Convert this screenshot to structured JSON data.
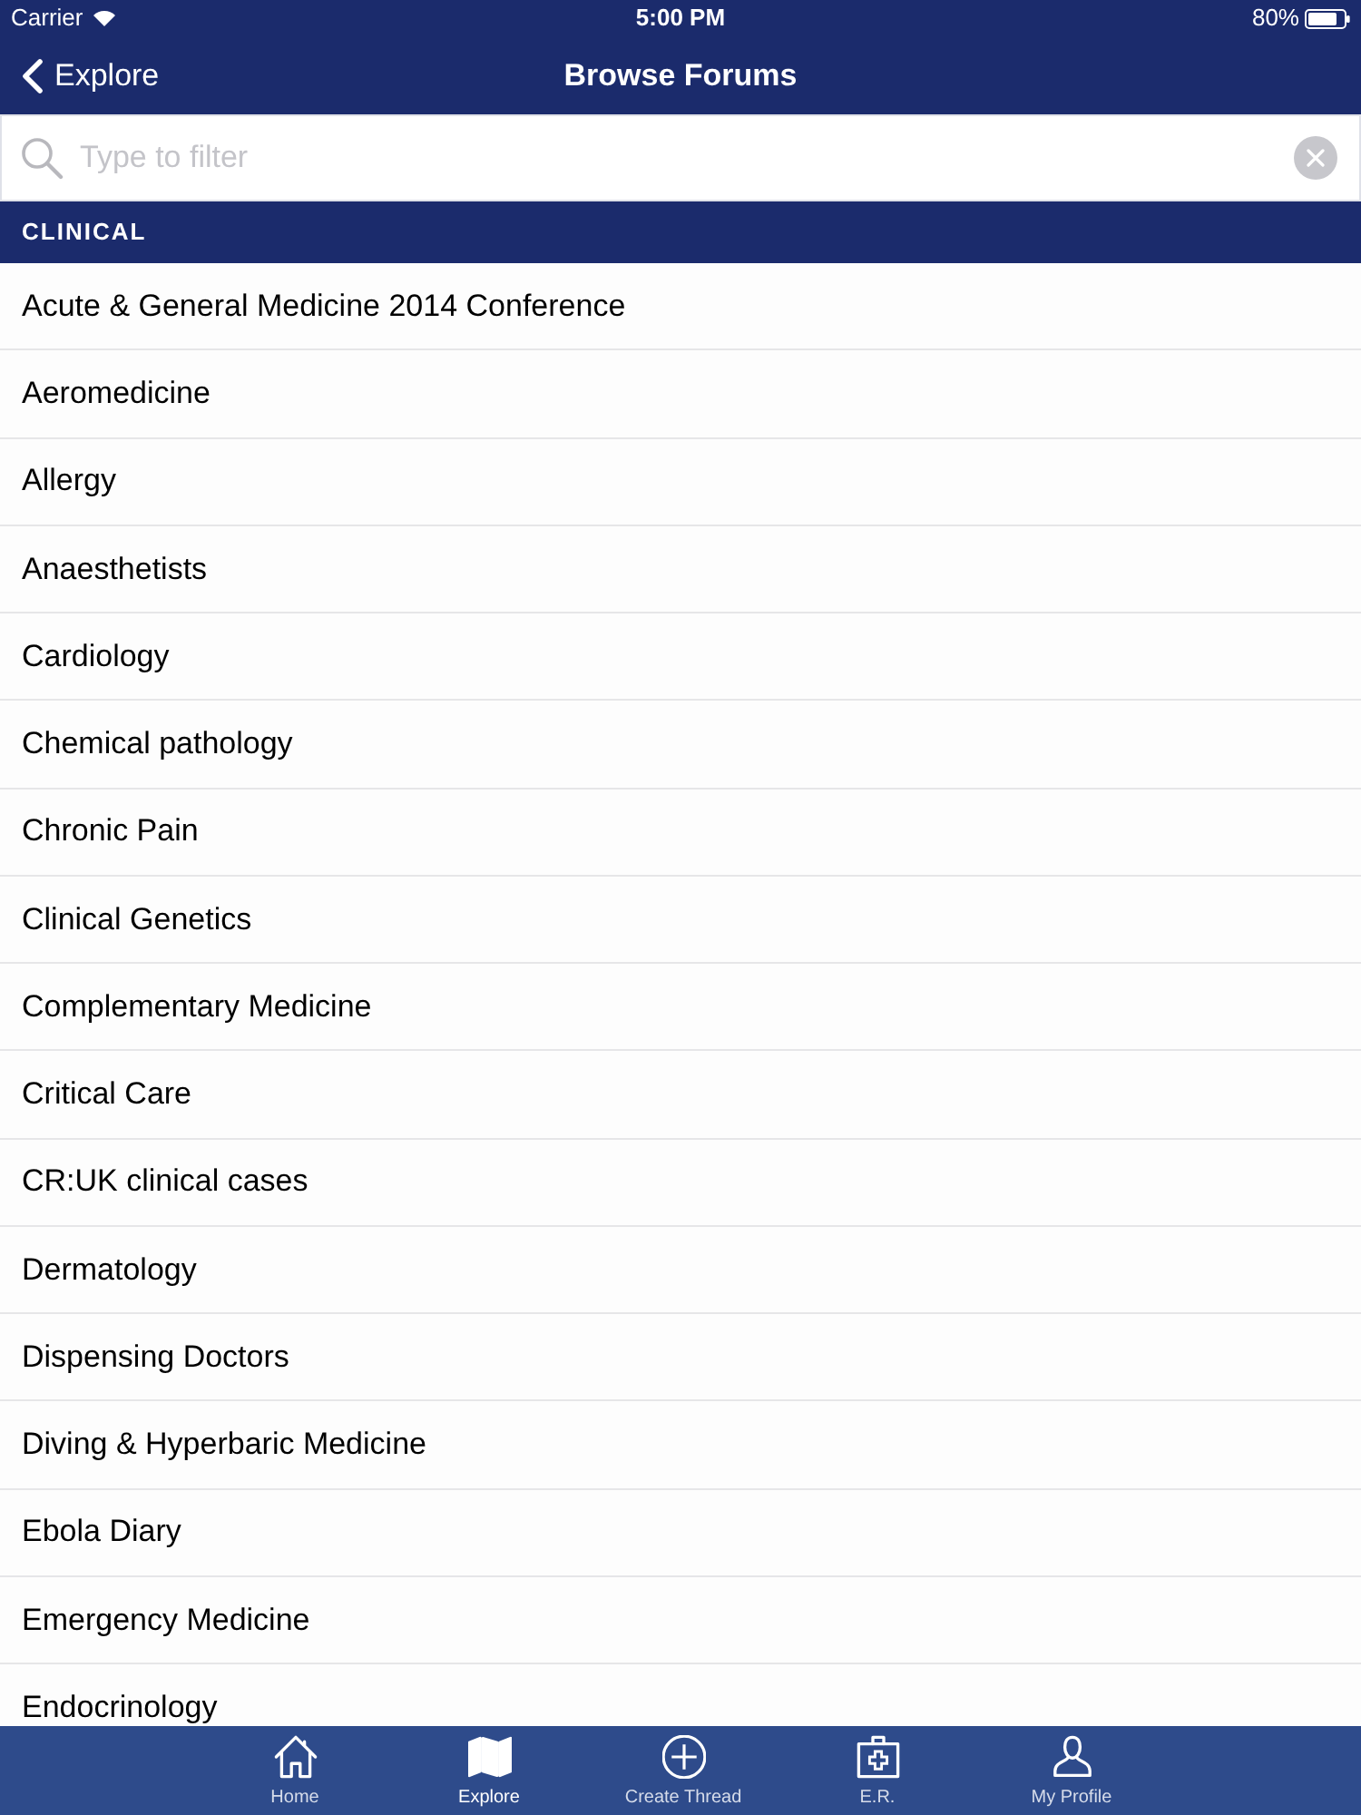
{
  "status_bar": {
    "carrier": "Carrier",
    "time": "5:00 PM",
    "battery": "80%"
  },
  "nav_bar": {
    "back": "Explore",
    "title": "Browse Forums"
  },
  "search": {
    "placeholder": "Type to filter"
  },
  "sections": [
    {
      "title": "CLINICAL",
      "items": [
        "Acute & General Medicine 2014 Conference",
        "Aeromedicine",
        "Allergy",
        "Anaesthetists",
        "Cardiology",
        "Chemical pathology",
        "Chronic Pain",
        "Clinical Genetics",
        "Complementary Medicine",
        "Critical Care",
        "CR:UK clinical cases",
        "Dermatology",
        "Dispensing Doctors",
        "Diving & Hyperbaric Medicine",
        "Ebola Diary",
        "Emergency Medicine",
        "Endocrinology"
      ]
    }
  ],
  "tab_bar": [
    {
      "label": "Home",
      "kind": "home",
      "selected": false
    },
    {
      "label": "Explore",
      "kind": "map",
      "selected": true
    },
    {
      "label": "Create Thread",
      "kind": "plus",
      "selected": false
    },
    {
      "label": "E.R.",
      "kind": "kit",
      "selected": false
    },
    {
      "label": "My Profile",
      "kind": "person",
      "selected": false
    }
  ]
}
